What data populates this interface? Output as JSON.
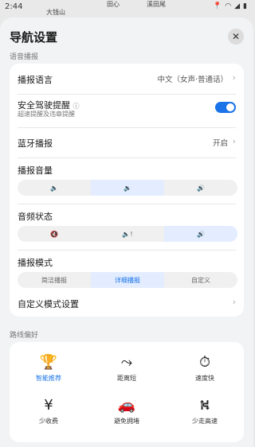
{
  "status": {
    "time": "2:44",
    "map_labels": [
      "大钱山",
      "田心",
      "溪田尾"
    ]
  },
  "header": {
    "title": "导航设置"
  },
  "voice_section": {
    "label": "语音播报",
    "broadcast_language": {
      "label": "播报语言",
      "value": "中文（女声·普通话）"
    },
    "safe_driving": {
      "label": "安全驾驶提醒",
      "sub": "超速提醒及违章提醒",
      "enabled": true
    },
    "bluetooth": {
      "label": "蓝牙播报",
      "value": "开启"
    },
    "volume": {
      "label": "播报音量",
      "options": [
        "🔈",
        "🔉",
        "🔊"
      ],
      "selected": 1
    },
    "audio_state": {
      "label": "音频状态",
      "options": [
        "🔇",
        "🔈!",
        "🔊"
      ],
      "selected": 2
    },
    "mode": {
      "label": "播报模式",
      "options": [
        "简洁播报",
        "详细播报",
        "自定义"
      ],
      "selected": 1
    },
    "custom_mode": {
      "label": "自定义模式设置"
    }
  },
  "route_section": {
    "label": "路线偏好",
    "options": [
      {
        "label": "智能推荐",
        "icon": "trophy-icon",
        "glyph": "🏆",
        "active": true
      },
      {
        "label": "距离短",
        "icon": "route-icon",
        "glyph": "⤳",
        "active": false
      },
      {
        "label": "速度快",
        "icon": "stopwatch-icon",
        "glyph": "⏱",
        "active": false
      },
      {
        "label": "少收费",
        "icon": "toll-icon",
        "glyph": "¥",
        "active": false
      },
      {
        "label": "避免拥堵",
        "icon": "car-icon",
        "glyph": "🚗",
        "active": false
      },
      {
        "label": "少走高速",
        "icon": "highway-icon",
        "glyph": "⛕",
        "active": false
      }
    ]
  }
}
